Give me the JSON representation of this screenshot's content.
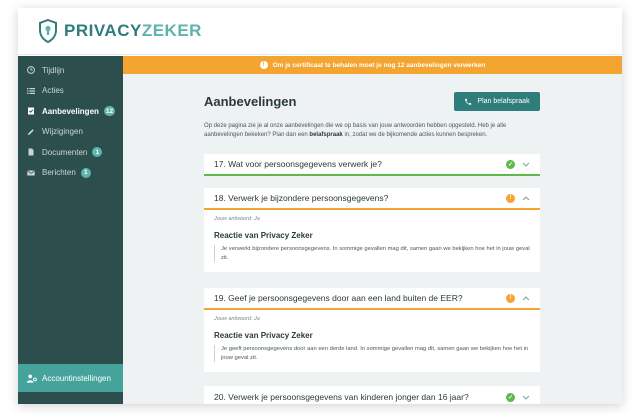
{
  "app": {
    "logo_left": "PRIVACY",
    "logo_right": "ZEKER"
  },
  "sidebar": {
    "items": [
      {
        "label": "Tijdlijn",
        "icon": "clock-icon",
        "badge": null
      },
      {
        "label": "Acties",
        "icon": "list-icon",
        "badge": null
      },
      {
        "label": "Aanbevelingen",
        "icon": "clipboard-icon",
        "badge": "12"
      },
      {
        "label": "Wijzigingen",
        "icon": "pencil-icon",
        "badge": null
      },
      {
        "label": "Documenten",
        "icon": "document-icon",
        "badge": "1"
      },
      {
        "label": "Berichten",
        "icon": "mail-icon",
        "badge": "1"
      }
    ],
    "active_index": 2,
    "account_label": "Accountinstellingen"
  },
  "banner": {
    "text": "Om je certificaat te behalen moet je nog 12 aanbevelingen verwerken",
    "icon": "exclamation-icon"
  },
  "main": {
    "title": "Aanbevelingen",
    "plan_button": "Plan belafspraak",
    "intro_part1": "Op deze pagina zie je al onze aanbevelingen die we op basis van jouw antwoorden hebben opgesteld. Heb je alle aanbevelingen bekeken? Plan dan een ",
    "intro_bold": "belafspraak",
    "intro_part2": " in, zodat we de bijkomende acties kunnen bespreken."
  },
  "questions": [
    {
      "title": "17. Wat voor persoonsgegevens verwerk je?",
      "status": "ok",
      "expanded": false
    },
    {
      "title": "18. Verwerk je bijzondere persoonsgegevens?",
      "status": "warn",
      "expanded": true,
      "answer": "Jouw antwoord: Ja",
      "reaction_title": "Reactie van Privacy Zeker",
      "reaction_text": "Je verwerkt bijzondere persoonsgegevens. In sommige gevallen mag dit, samen gaan we bekijken hoe het in jouw geval zit."
    },
    {
      "title": "19. Geef je persoonsgegevens door aan een land buiten de EER?",
      "status": "warn",
      "expanded": true,
      "answer": "Jouw antwoord: Ja",
      "reaction_title": "Reactie van Privacy Zeker",
      "reaction_text": "Je geeft persoonsgegevens door aan een derde land. In sommige gevallen mag dit, samen gaan we bekijken hoe het in jouw geval zit."
    },
    {
      "title": "20. Verwerk je persoonsgegevens van kinderen jonger dan 16 jaar?",
      "status": "ok",
      "expanded": false
    }
  ],
  "colors": {
    "brand": "#2e7d7a",
    "sidebar": "#2c4f4e",
    "accent": "#5fb3ad",
    "warning": "#f4a430",
    "success": "#5fb84c"
  }
}
